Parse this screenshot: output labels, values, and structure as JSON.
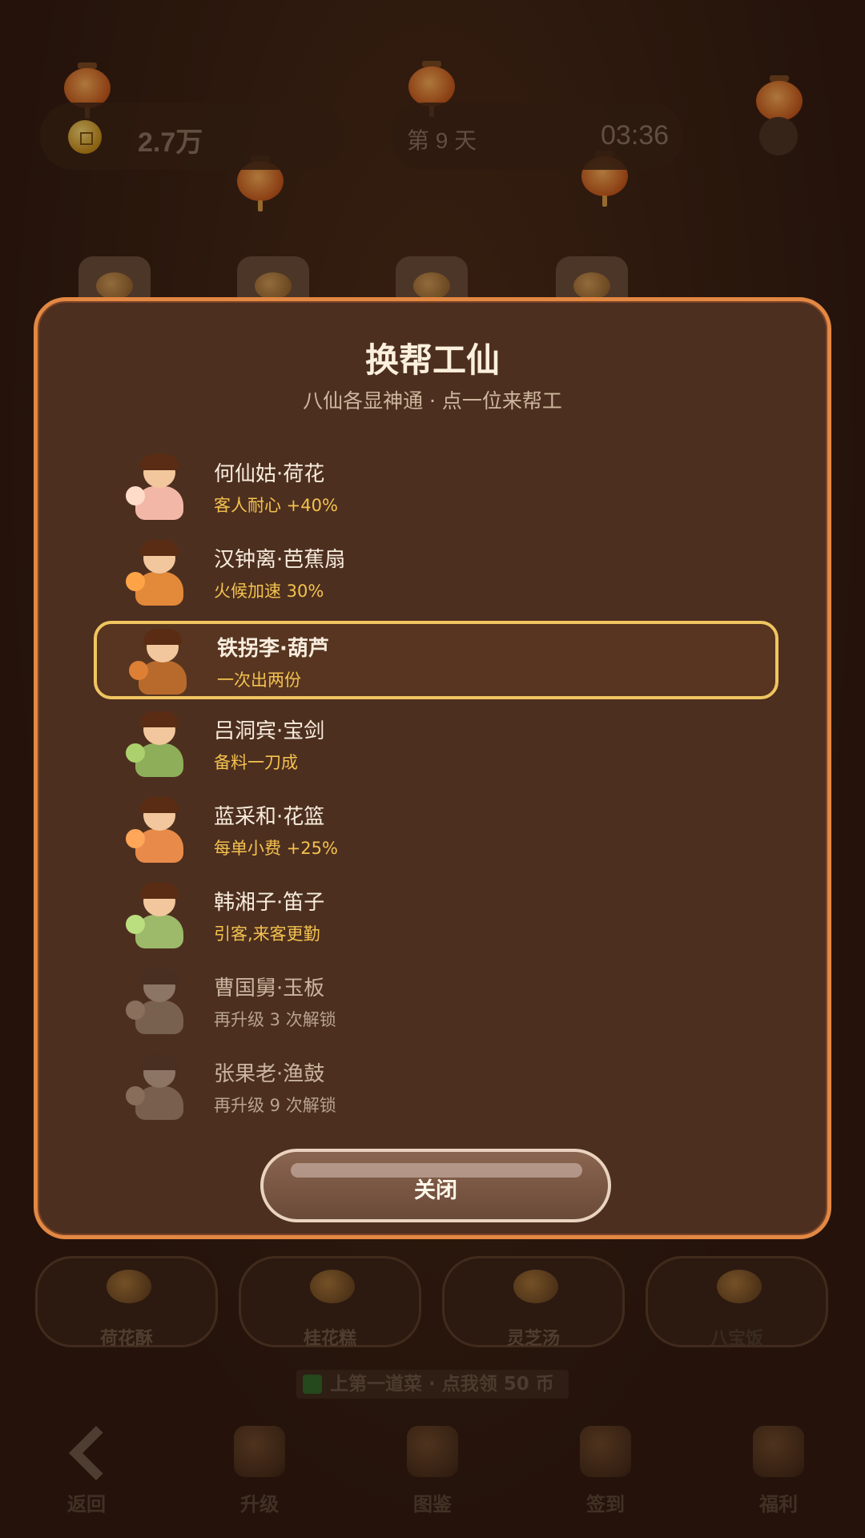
{
  "hud": {
    "coins": "2.7万",
    "day": "第 9 天",
    "timer": "03:36"
  },
  "dishes": [
    "荷花酥",
    "桂花糕",
    "灵芝汤",
    "八宝饭"
  ],
  "hint": "上第一道菜 · 点我领 50 币",
  "nav": [
    "返回",
    "升级",
    "图鉴",
    "签到",
    "福利"
  ],
  "modal": {
    "title": "换帮工仙",
    "subtitle": "八仙各显神通 · 点一位来帮工",
    "helpers": [
      {
        "name": "何仙姑·荷花",
        "effect": "客人耐心 +40%",
        "locked": false,
        "selected": false,
        "color": "#f3b7a8"
      },
      {
        "name": "汉钟离·芭蕉扇",
        "effect": "火候加速 30%",
        "locked": false,
        "selected": false,
        "color": "#e3893a"
      },
      {
        "name": "铁拐李·葫芦",
        "effect": "一次出两份",
        "locked": false,
        "selected": true,
        "color": "#b86a2c"
      },
      {
        "name": "吕洞宾·宝剑",
        "effect": "备料一刀成",
        "locked": false,
        "selected": false,
        "color": "#8fae5a"
      },
      {
        "name": "蓝采和·花篮",
        "effect": "每单小费 +25%",
        "locked": false,
        "selected": false,
        "color": "#e88a4a"
      },
      {
        "name": "韩湘子·笛子",
        "effect": "引客,来客更勤",
        "locked": false,
        "selected": false,
        "color": "#9cba6a"
      },
      {
        "name": "曹国舅·玉板",
        "effect": "再升级 3 次解锁",
        "locked": true,
        "selected": false,
        "color": "#c89a6a"
      },
      {
        "name": "张果老·渔鼓",
        "effect": "再升级 9 次解锁",
        "locked": true,
        "selected": false,
        "color": "#c8946a"
      }
    ],
    "close_label": "关闭"
  }
}
